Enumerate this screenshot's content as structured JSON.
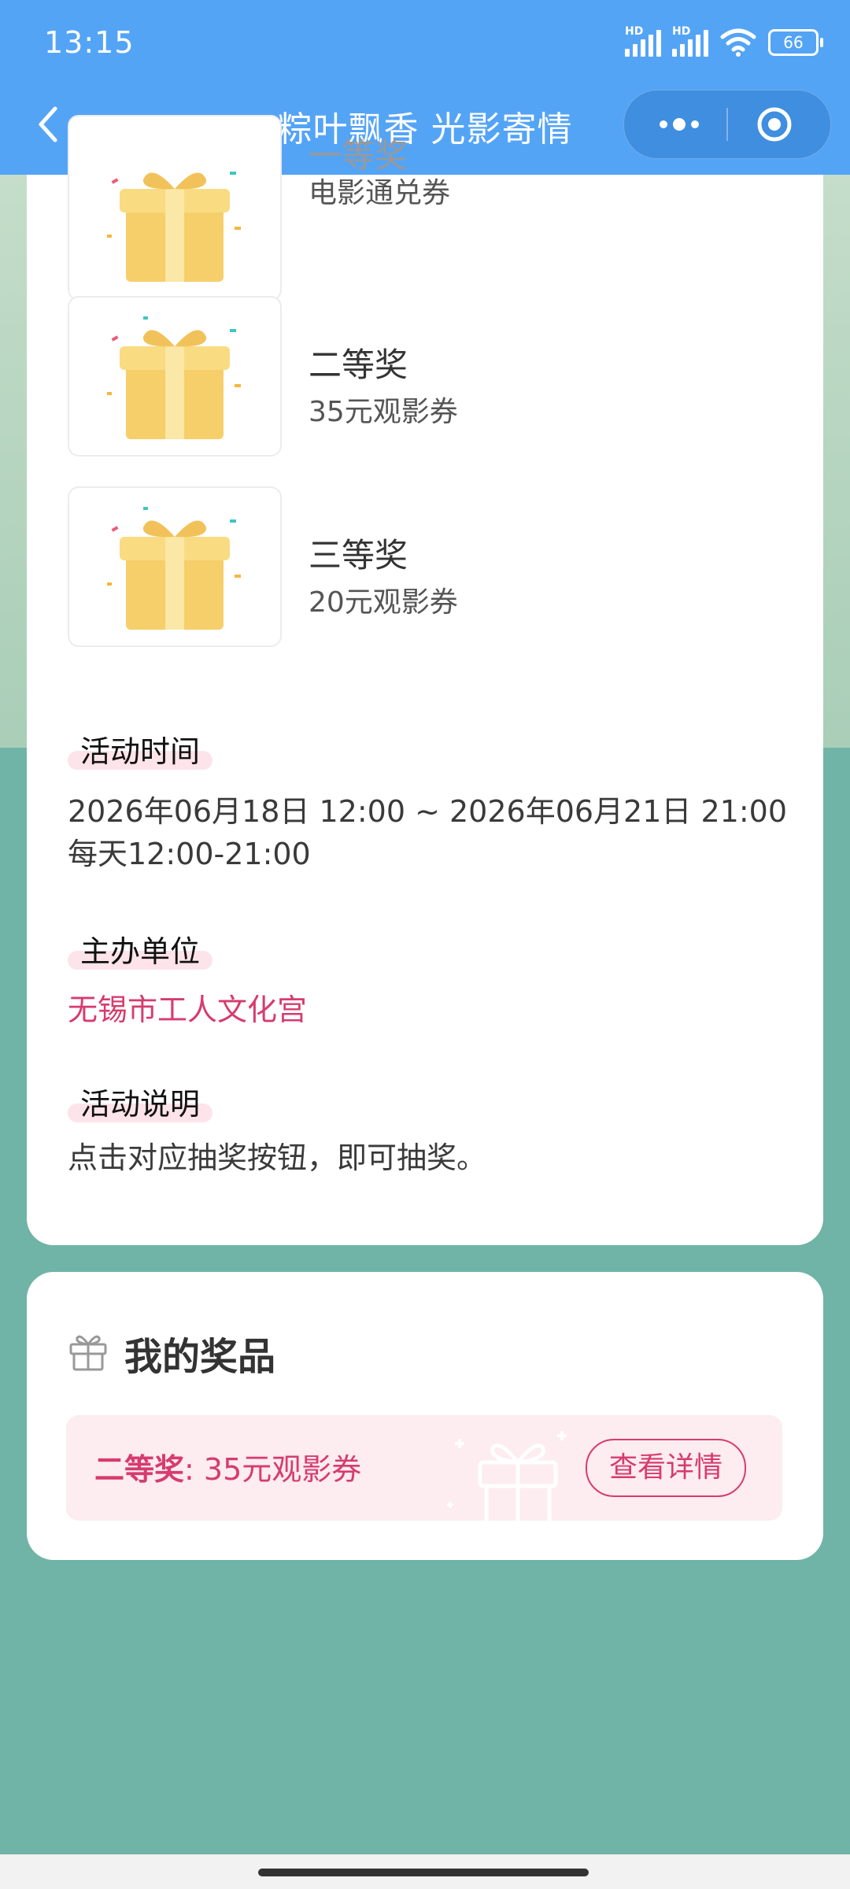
{
  "status_bar": {
    "time": "13:15",
    "battery": "66",
    "hd": "HD"
  },
  "nav": {
    "title": "粽叶飘香 光影寄情"
  },
  "prizes": [
    {
      "name": "一等奖",
      "desc": "电影通兑券"
    },
    {
      "name": "二等奖",
      "desc": "35元观影券"
    },
    {
      "name": "三等奖",
      "desc": "20元观影券"
    }
  ],
  "sections": {
    "time": {
      "title": "活动时间",
      "line1": "2026年06月18日 12:00 ~ 2026年06月21日 21:00",
      "line2": "每天12:00-21:00"
    },
    "organizer": {
      "title": "主办单位",
      "value": "无锡市工人文化宫"
    },
    "description": {
      "title": "活动说明",
      "value": "点击对应抽奖按钮，即可抽奖。"
    }
  },
  "my_prizes": {
    "title": "我的奖品",
    "item_level": "二等奖",
    "item_sep": ": ",
    "item_desc": "35元观影券",
    "detail_button": "查看详情"
  },
  "colors": {
    "nav_bg": "#54a4f6",
    "accent": "#d63c6e",
    "page_bg": "#6fb4a6"
  },
  "icons": [
    "back-icon",
    "more-icon",
    "target-icon",
    "gift-box-icon",
    "gift-outline-icon"
  ]
}
